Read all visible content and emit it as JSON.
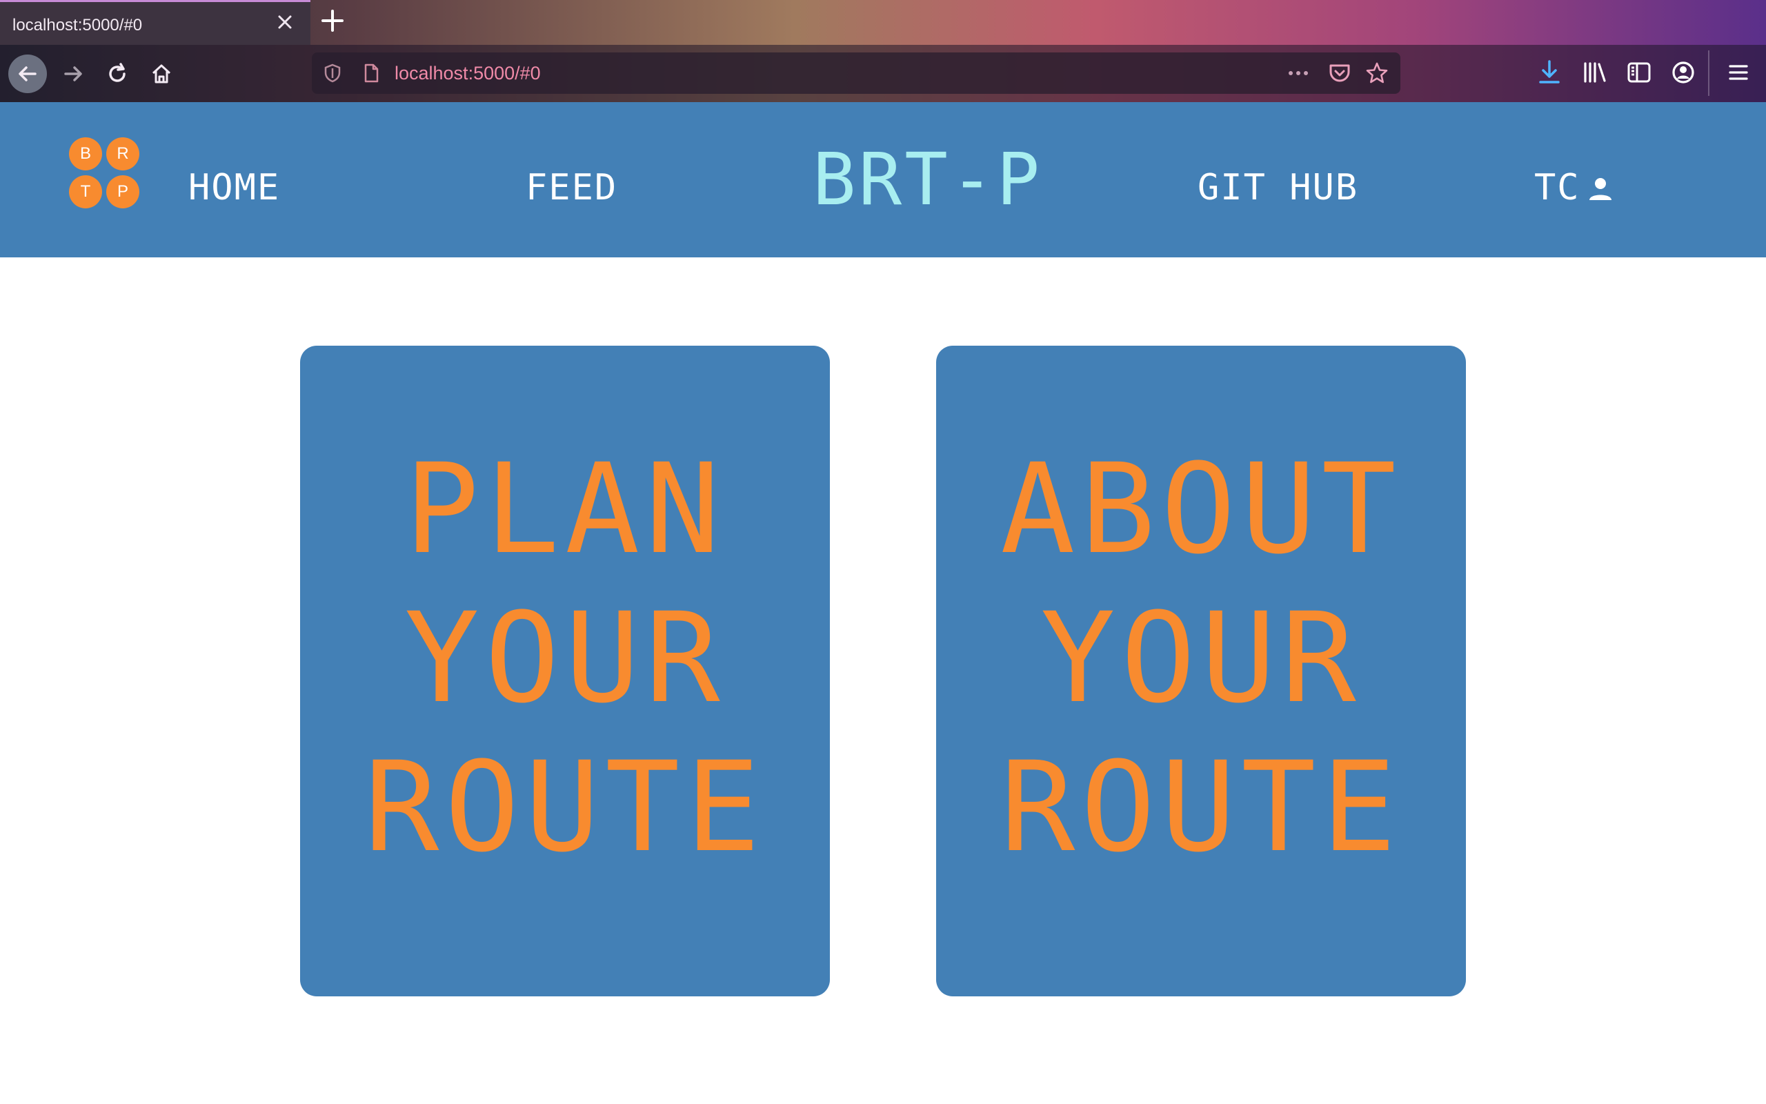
{
  "browser": {
    "tab": {
      "title": "localhost:5000/#0"
    },
    "url": "localhost:5000/#0"
  },
  "header": {
    "logo_letters": [
      "B",
      "R",
      "T",
      "P"
    ],
    "nav": {
      "home": "HOME",
      "feed": "FEED",
      "github": "GIT HUB",
      "user": "TC"
    },
    "brand": "BRT-P"
  },
  "cards": [
    {
      "lines": [
        "PLAN",
        "YOUR",
        "ROUTE"
      ]
    },
    {
      "lines": [
        "ABOUT",
        "YOUR",
        "ROUTE"
      ]
    }
  ],
  "colors": {
    "header_bg": "#4380b6",
    "card_bg": "#4380b6",
    "accent_orange": "#f88b2f",
    "brand_cyan": "#a8eef0"
  }
}
